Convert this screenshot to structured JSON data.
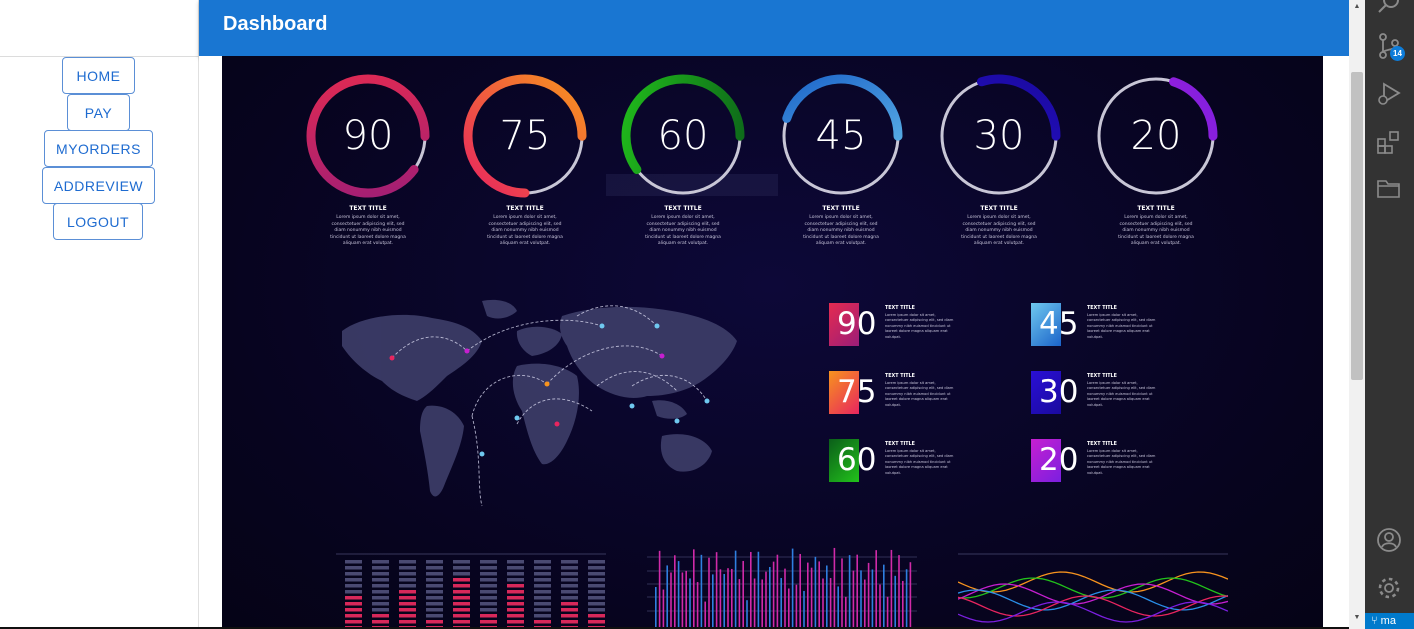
{
  "header": {
    "title": "Dashboard"
  },
  "sidebar": {
    "items": [
      {
        "label": "HOME"
      },
      {
        "label": "PAY"
      },
      {
        "label": "MYORDERS"
      },
      {
        "label": "ADDREVIEW"
      },
      {
        "label": "LOGOUT"
      }
    ]
  },
  "infographic": {
    "gauges": [
      {
        "value": "90",
        "percent": 90,
        "title": "TEXT TITLE",
        "body": "Lorem ipsum dolor sit amet, consectetuer adipiscing elit, sed diam nonummy nibh euismod tincidunt ut laoreet dolore magna aliquam erat volutpat.",
        "color_start": "#e52b50",
        "color_end": "#9b1d78"
      },
      {
        "value": "75",
        "percent": 75,
        "title": "TEXT TITLE",
        "body": "Lorem ipsum dolor sit amet, consectetuer adipiscing elit, sed diam nonummy nibh euismod tincidunt ut laoreet dolore magna aliquam erat volutpat.",
        "color_start": "#f7931e",
        "color_end": "#e8255f"
      },
      {
        "value": "60",
        "percent": 60,
        "title": "TEXT TITLE",
        "body": "Lorem ipsum dolor sit amet, consectetuer adipiscing elit, sed diam nonummy nibh euismod tincidunt ut laoreet dolore magna aliquam erat volutpat.",
        "color_start": "#0b5e1a",
        "color_end": "#22c21b"
      },
      {
        "value": "45",
        "percent": 45,
        "title": "TEXT TITLE",
        "body": "Lorem ipsum dolor sit amet, consectetuer adipiscing elit, sed diam nonummy nibh euismod tincidunt ut laoreet dolore magna aliquam erat volutpat.",
        "color_start": "#6fc8ef",
        "color_end": "#1b63c9"
      },
      {
        "value": "30",
        "percent": 30,
        "title": "TEXT TITLE",
        "body": "Lorem ipsum dolor sit amet, consectetuer adipiscing elit, sed diam nonummy nibh euismod tincidunt ut laoreet dolore magna aliquam erat volutpat.",
        "color_start": "#2a0fd6",
        "color_end": "#1a0a9e"
      },
      {
        "value": "20",
        "percent": 20,
        "title": "TEXT TITLE",
        "body": "Lorem ipsum dolor sit amet, consectetuer adipiscing elit, sed diam nonummy nibh euismod tincidunt ut laoreet dolore magna aliquam erat volutpat.",
        "color_start": "#c61fd0",
        "color_end": "#7b1fe0"
      }
    ],
    "stats": [
      {
        "value": "90",
        "title": "TEXT TITLE",
        "body": "Lorem ipsum dolor sit amet, consectetuer adipiscing elit, sed diam nonummy nibh euismod tincidunt ut laoreet dolore magna aliquam erat volutpat.",
        "color_start": "#e52b50",
        "color_end": "#9b1d78"
      },
      {
        "value": "45",
        "title": "TEXT TITLE",
        "body": "Lorem ipsum dolor sit amet, consectetuer adipiscing elit, sed diam nonummy nibh euismod tincidunt ut laoreet dolore magna aliquam erat volutpat.",
        "color_start": "#6fc8ef",
        "color_end": "#1b63c9"
      },
      {
        "value": "75",
        "title": "TEXT TITLE",
        "body": "Lorem ipsum dolor sit amet, consectetuer adipiscing elit, sed diam nonummy nibh euismod tincidunt ut laoreet dolore magna aliquam erat volutpat.",
        "color_start": "#f7931e",
        "color_end": "#e8255f"
      },
      {
        "value": "30",
        "title": "TEXT TITLE",
        "body": "Lorem ipsum dolor sit amet, consectetuer adipiscing elit, sed diam nonummy nibh euismod tincidunt ut laoreet dolore magna aliquam erat volutpat.",
        "color_start": "#2a0fd6",
        "color_end": "#1a0a9e"
      },
      {
        "value": "60",
        "title": "TEXT TITLE",
        "body": "Lorem ipsum dolor sit amet, consectetuer adipiscing elit, sed diam nonummy nibh euismod tincidunt ut laoreet dolore magna aliquam erat volutpat.",
        "color_start": "#0b5e1a",
        "color_end": "#22c21b"
      },
      {
        "value": "20",
        "title": "TEXT TITLE",
        "body": "Lorem ipsum dolor sit amet, consectetuer adipiscing elit, sed diam nonummy nibh euismod tincidunt ut laoreet dolore magna aliquam erat volutpat.",
        "color_start": "#c61fd0",
        "color_end": "#7b1fe0"
      }
    ]
  },
  "activity_bar": {
    "icons": [
      "search-icon",
      "source-control-icon",
      "run-debug-icon",
      "extensions-icon",
      "explorer-icon",
      "account-icon",
      "settings-gear-icon"
    ],
    "source_control_badge": "14"
  },
  "status_bar": {
    "branch": "ma"
  },
  "colors": {
    "header": "#1976d2",
    "accent": "#1e6bd0",
    "background": "#07041f",
    "activity_bar": "#333333",
    "status_bar": "#007acc"
  }
}
